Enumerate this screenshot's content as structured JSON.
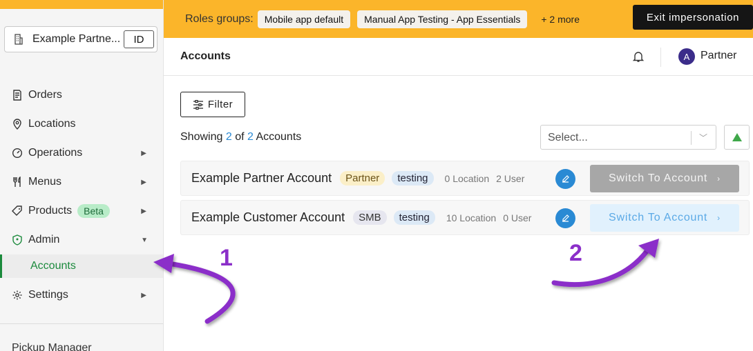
{
  "banner": {
    "roles_label": "Roles groups:",
    "chips": [
      "Mobile app default",
      "Manual App Testing - App Essentials"
    ],
    "more_label": "+ 2 more",
    "exit_label": "Exit impersonation"
  },
  "sidebar": {
    "partner_name": "Example Partne...",
    "partner_id": "ID",
    "items": [
      {
        "label": "Orders",
        "icon": "orders-icon"
      },
      {
        "label": "Locations",
        "icon": "location-pin-icon"
      },
      {
        "label": "Operations",
        "icon": "gauge-icon"
      },
      {
        "label": "Menus",
        "icon": "fork-knife-icon"
      },
      {
        "label": "Products",
        "icon": "tag-icon",
        "badge": "Beta"
      },
      {
        "label": "Admin",
        "icon": "shield-icon"
      },
      {
        "label": "Settings",
        "icon": "gear-icon"
      }
    ],
    "active_sub": "Accounts",
    "footer": "Pickup Manager"
  },
  "header": {
    "title": "Accounts",
    "user_initial": "A",
    "user_name": "Partner"
  },
  "main": {
    "filter_label": "Filter",
    "showing_prefix": "Showing",
    "showing_count": "2",
    "showing_of": "of",
    "showing_total": "2",
    "showing_suffix": "Accounts",
    "select_placeholder": "Select...",
    "accounts": [
      {
        "name": "Example Partner Account",
        "tag": "Partner",
        "tag2": "testing",
        "locations": "0 Location",
        "users": "2 User",
        "button": "Switch To Account"
      },
      {
        "name": "Example Customer Account",
        "tag": "SMB",
        "tag2": "testing",
        "locations": "10 Location",
        "users": "0 User",
        "button": "Switch To Account"
      }
    ]
  },
  "annotations": {
    "label_1": "1",
    "label_2": "2",
    "color": "#8b2fc9"
  },
  "colors": {
    "accent_yellow": "#fbb52a",
    "green": "#1b8a3c",
    "blue": "#2a8ad4"
  }
}
